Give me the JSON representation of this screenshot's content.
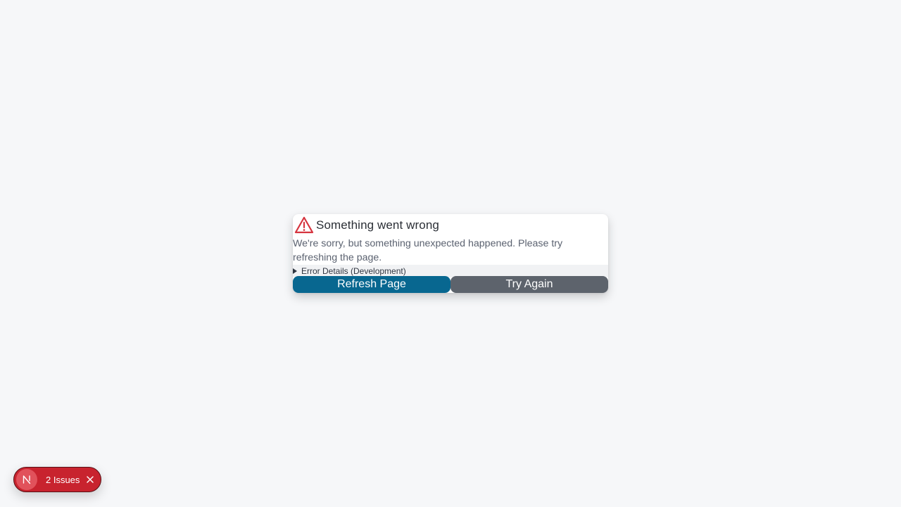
{
  "error_card": {
    "icon": "warning-triangle-icon",
    "title": "Something went wrong",
    "message": "We're sorry, but something unexpected happened. Please try refreshing the page.",
    "details_label": "Error Details (Development)",
    "refresh_label": "Refresh Page",
    "retry_label": "Try Again"
  },
  "issues_indicator": {
    "logo": "N",
    "label": "2 Issues",
    "close_icon": "close-icon"
  },
  "colors": {
    "background": "#f6f7f9",
    "warning_icon": "#d6343f",
    "refresh_button": "#086790",
    "retry_button": "#5d636c",
    "issues_pill": "#c8232e"
  }
}
